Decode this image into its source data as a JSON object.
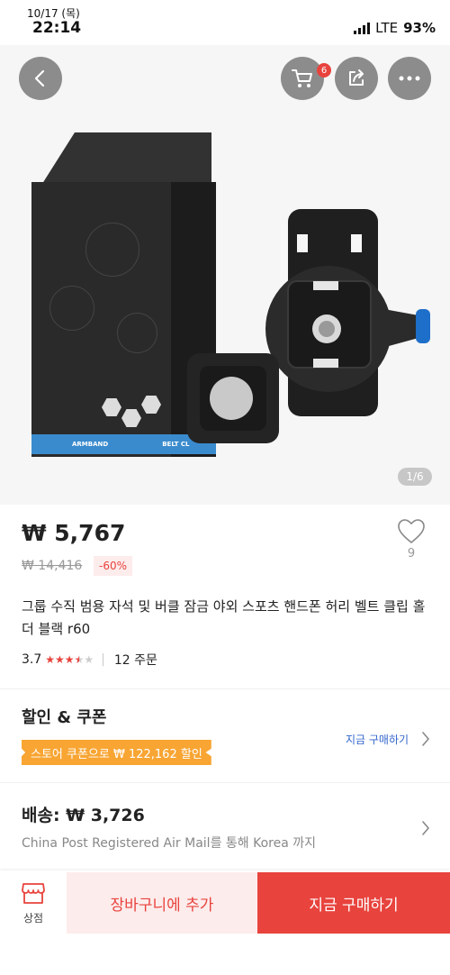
{
  "status_bar": {
    "date": "10/17 (목)",
    "time": "22:14",
    "network": "LTE",
    "battery": "93%"
  },
  "header": {
    "cart_badge": "6",
    "icons": [
      "back-arrow-icon",
      "cart-icon",
      "share-icon",
      "more-icon"
    ]
  },
  "gallery": {
    "counter": "1/6",
    "package_text": [
      "ARMBAND",
      "BELT CL"
    ]
  },
  "product": {
    "price": "₩ 5,767",
    "original_price": "₩ 14,416",
    "discount": "-60%",
    "likes": "9",
    "title": "그룹 수직 범용 자석 및 버클 잠금 야외 스포츠 핸드폰 허리 벨트 클립 홀더 블랙 r60",
    "rating": "3.7",
    "stars": 3.7,
    "orders": "12 주문"
  },
  "coupon_section": {
    "title": "할인 & 쿠폰",
    "coupon_label": "스토어 쿠폰으로 ₩ 122,162 할인",
    "buy_link": "지금 구매하기"
  },
  "shipping": {
    "price": "배송: ₩ 3,726",
    "description": "China Post Registered Air Mail를 통해 Korea 까지"
  },
  "bottom_bar": {
    "store_label": "상점",
    "add_to_cart": "장바구니에 추가",
    "buy_now": "지금 구매하기"
  },
  "colors": {
    "accent": "#e8433d",
    "coupon": "#f8a533",
    "link": "#3366cc",
    "stripe": "#3a8bcd"
  }
}
